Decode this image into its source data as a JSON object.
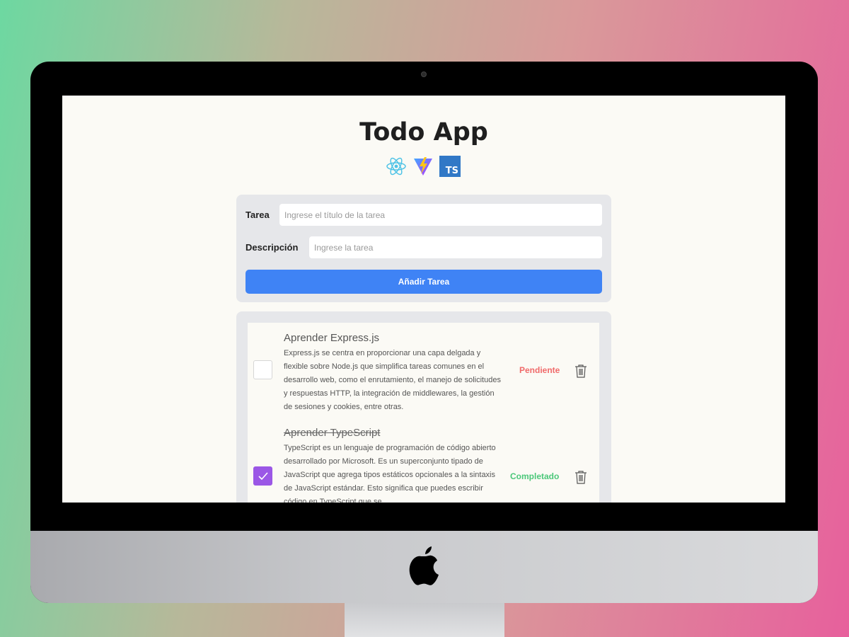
{
  "app": {
    "title": "Todo App",
    "tech_logos": [
      "react-icon",
      "vite-icon",
      "typescript-icon"
    ],
    "ts_badge_text": "TS"
  },
  "form": {
    "title_label": "Tarea",
    "title_placeholder": "Ingrese el título de la tarea",
    "description_label": "Descripción",
    "description_placeholder": "Ingrese la tarea",
    "submit_label": "Añadir Tarea"
  },
  "tasks": [
    {
      "title": "Aprender Express.js",
      "description": "Express.js se centra en proporcionar una capa delgada y flexible sobre Node.js que simplifica tareas comunes en el desarrollo web, como el enrutamiento, el manejo de solicitudes y respuestas HTTP, la integración de middlewares, la gestión de sesiones y cookies, entre otras.",
      "completed": false,
      "status": "Pendiente"
    },
    {
      "title": "Aprender TypeScript",
      "description": "TypeScript es un lenguaje de programación de código abierto desarrollado por Microsoft. Es un superconjunto tipado de JavaScript que agrega tipos estáticos opcionales a la sintaxis de JavaScript estándar. Esto significa que puedes escribir código en TypeScript que se",
      "completed": true,
      "status": "Completado"
    }
  ],
  "colors": {
    "primary": "#3f83f5",
    "pending": "#f06a6a",
    "completed": "#4cc87a",
    "checkbox_checked": "#9b57e6",
    "card_bg": "#e6e7ea",
    "screen_bg": "#fbfaf5"
  }
}
